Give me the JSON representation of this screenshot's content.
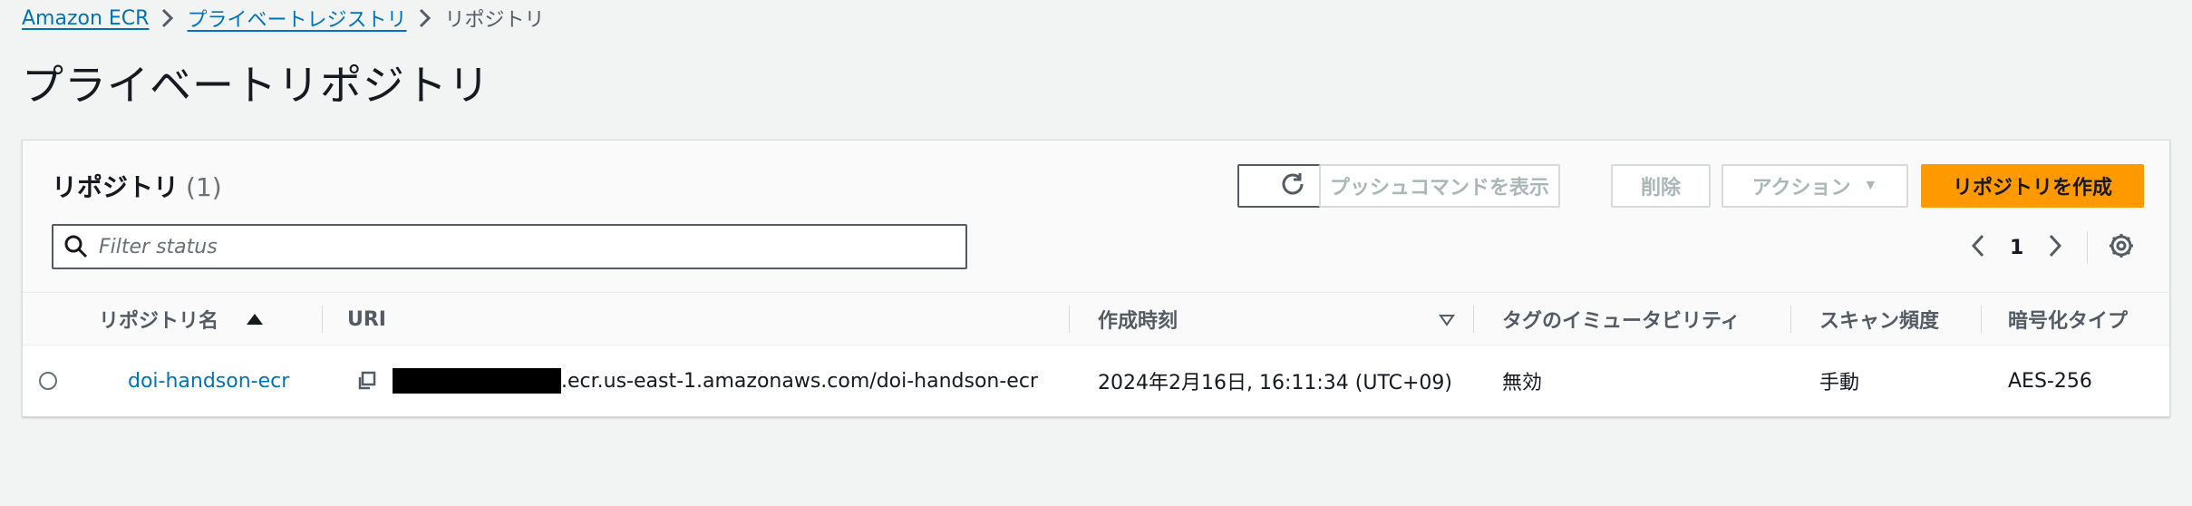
{
  "breadcrumb": {
    "root": "Amazon ECR",
    "parent": "プライベートレジストリ",
    "current": "リポジトリ"
  },
  "page_title": "プライベートリポジトリ",
  "panel": {
    "title": "リポジトリ",
    "count": "(1)",
    "buttons": {
      "refresh_icon": "refresh-icon",
      "push": "プッシュコマンドを表示",
      "delete": "削除",
      "action": "アクション",
      "create": "リポジトリを作成"
    },
    "filter": {
      "placeholder": "Filter status"
    },
    "pager": {
      "page": "1"
    }
  },
  "table": {
    "headers": {
      "name": "リポジトリ名",
      "uri": "URI",
      "created": "作成時刻",
      "tag_mutability": "タグのイミュータビリティ",
      "scan": "スキャン頻度",
      "encryption": "暗号化タイプ"
    },
    "rows": [
      {
        "name": "doi-handson-ecr",
        "uri_suffix": ".ecr.us-east-1.amazonaws.com/doi-handson-ecr",
        "created": "2024年2月16日, 16:11:34 (UTC+09)",
        "tag_mutability": "無効",
        "scan": "手動",
        "encryption": "AES-256"
      }
    ]
  },
  "colors": {
    "link": "#0073bb",
    "primary": "#ff9900",
    "background": "#f2f3f3"
  }
}
